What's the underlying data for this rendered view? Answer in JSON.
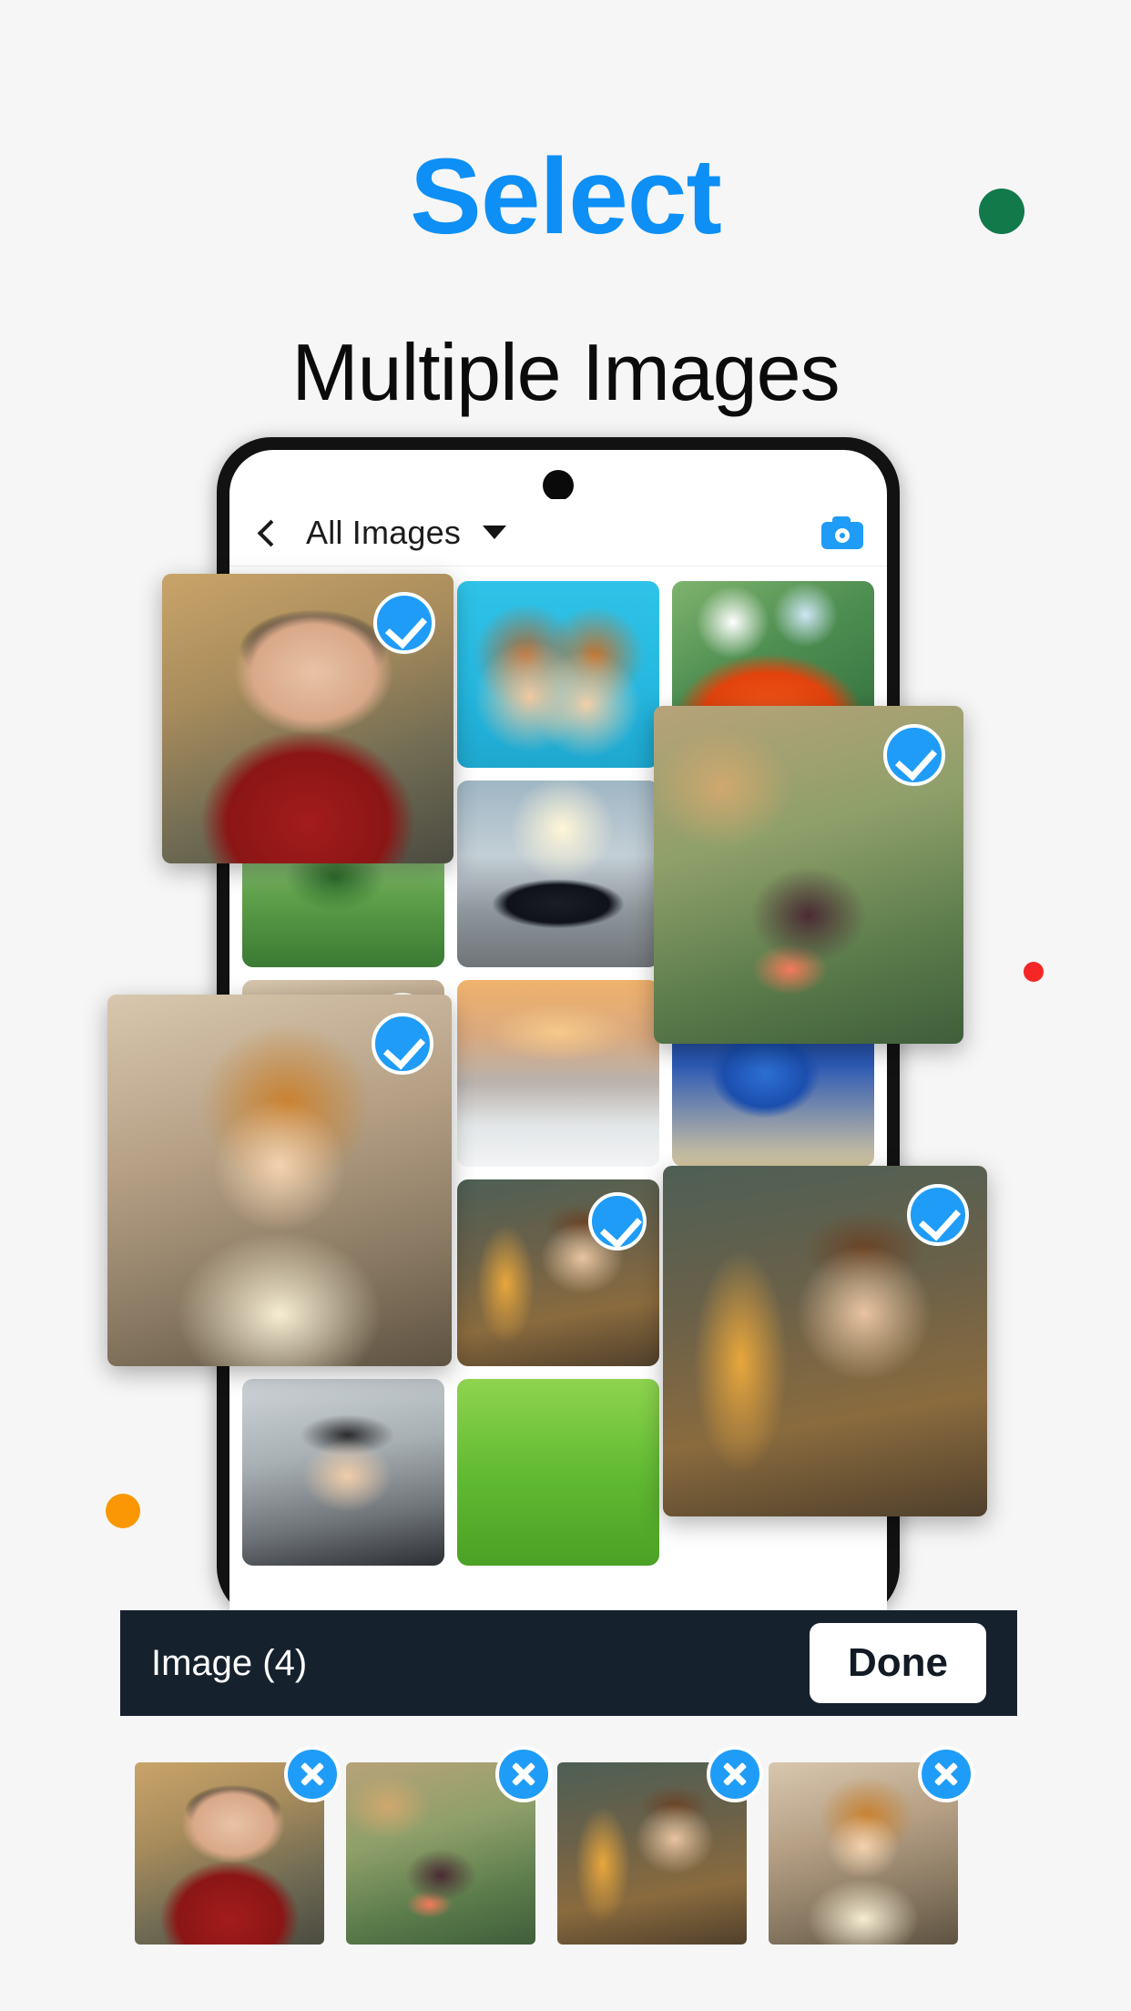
{
  "heading": {
    "title": "Select",
    "subtitle": "Multiple Images",
    "title_color": "#0d8ff5",
    "subtitle_color": "#0b0b0b"
  },
  "decor": {
    "dot_green_color": "#12794a",
    "dot_red_color": "#f42626",
    "dot_orange_color": "#fb9704"
  },
  "phone": {
    "appbar": {
      "back_icon": "chevron-left-icon",
      "title": "All Images",
      "dropdown_icon": "caret-down-icon",
      "camera_icon": "camera-icon",
      "accent_color": "#1f9cf7"
    },
    "grid": [
      {
        "name": "woman-in-red-jacket",
        "style": "ph-woman-red",
        "selected": true
      },
      {
        "name": "friends-3d-glasses",
        "style": "ph-3dglasses",
        "selected": false
      },
      {
        "name": "orange-flower",
        "style": "ph-orangeflower",
        "selected": false
      },
      {
        "name": "green-meadow-tree",
        "style": "ph-meadow",
        "selected": false
      },
      {
        "name": "sports-car-road",
        "style": "ph-car",
        "selected": false
      },
      {
        "name": "butterfly-on-flower",
        "style": "ph-butterfly",
        "selected": true
      },
      {
        "name": "redhead-woman-straw-hat",
        "style": "ph-redhead",
        "selected": true
      },
      {
        "name": "winter-sunset-trees",
        "style": "ph-winter",
        "selected": false
      },
      {
        "name": "blue-cartoon-hedgehog",
        "style": "ph-sonic",
        "selected": false
      },
      {
        "name": "neon-cyber-woman",
        "style": "ph-neon",
        "selected": false
      },
      {
        "name": "woman-eiffel-tower",
        "style": "ph-eiffel",
        "selected": true
      },
      {
        "name": "lake-forest",
        "style": "ph-lake",
        "selected": false
      },
      {
        "name": "woman-black-hat",
        "style": "ph-hatgirl",
        "selected": false
      },
      {
        "name": "green-grass-field",
        "style": "ph-grass",
        "selected": false
      }
    ],
    "popped": [
      {
        "name": "woman-in-red-jacket",
        "style": "ph-woman-red",
        "badge": "check-icon"
      },
      {
        "name": "butterfly-on-flower",
        "style": "ph-butterfly",
        "badge": "check-icon"
      },
      {
        "name": "redhead-woman-straw-hat",
        "style": "ph-redhead",
        "badge": "check-icon"
      },
      {
        "name": "woman-eiffel-tower",
        "style": "ph-eiffel",
        "badge": "check-icon"
      }
    ]
  },
  "bottombar": {
    "count_label": "Image (4)",
    "done_label": "Done",
    "background": "#16212e",
    "done_bg": "#ffffff"
  },
  "selected_strip": [
    {
      "name": "woman-in-red-jacket",
      "style": "ph-woman-red",
      "remove_icon": "close-icon"
    },
    {
      "name": "butterfly-on-flower",
      "style": "ph-butterfly",
      "remove_icon": "close-icon"
    },
    {
      "name": "woman-eiffel-tower",
      "style": "ph-eiffel",
      "remove_icon": "close-icon"
    },
    {
      "name": "redhead-woman-straw-hat",
      "style": "ph-redhead",
      "remove_icon": "close-icon"
    }
  ]
}
